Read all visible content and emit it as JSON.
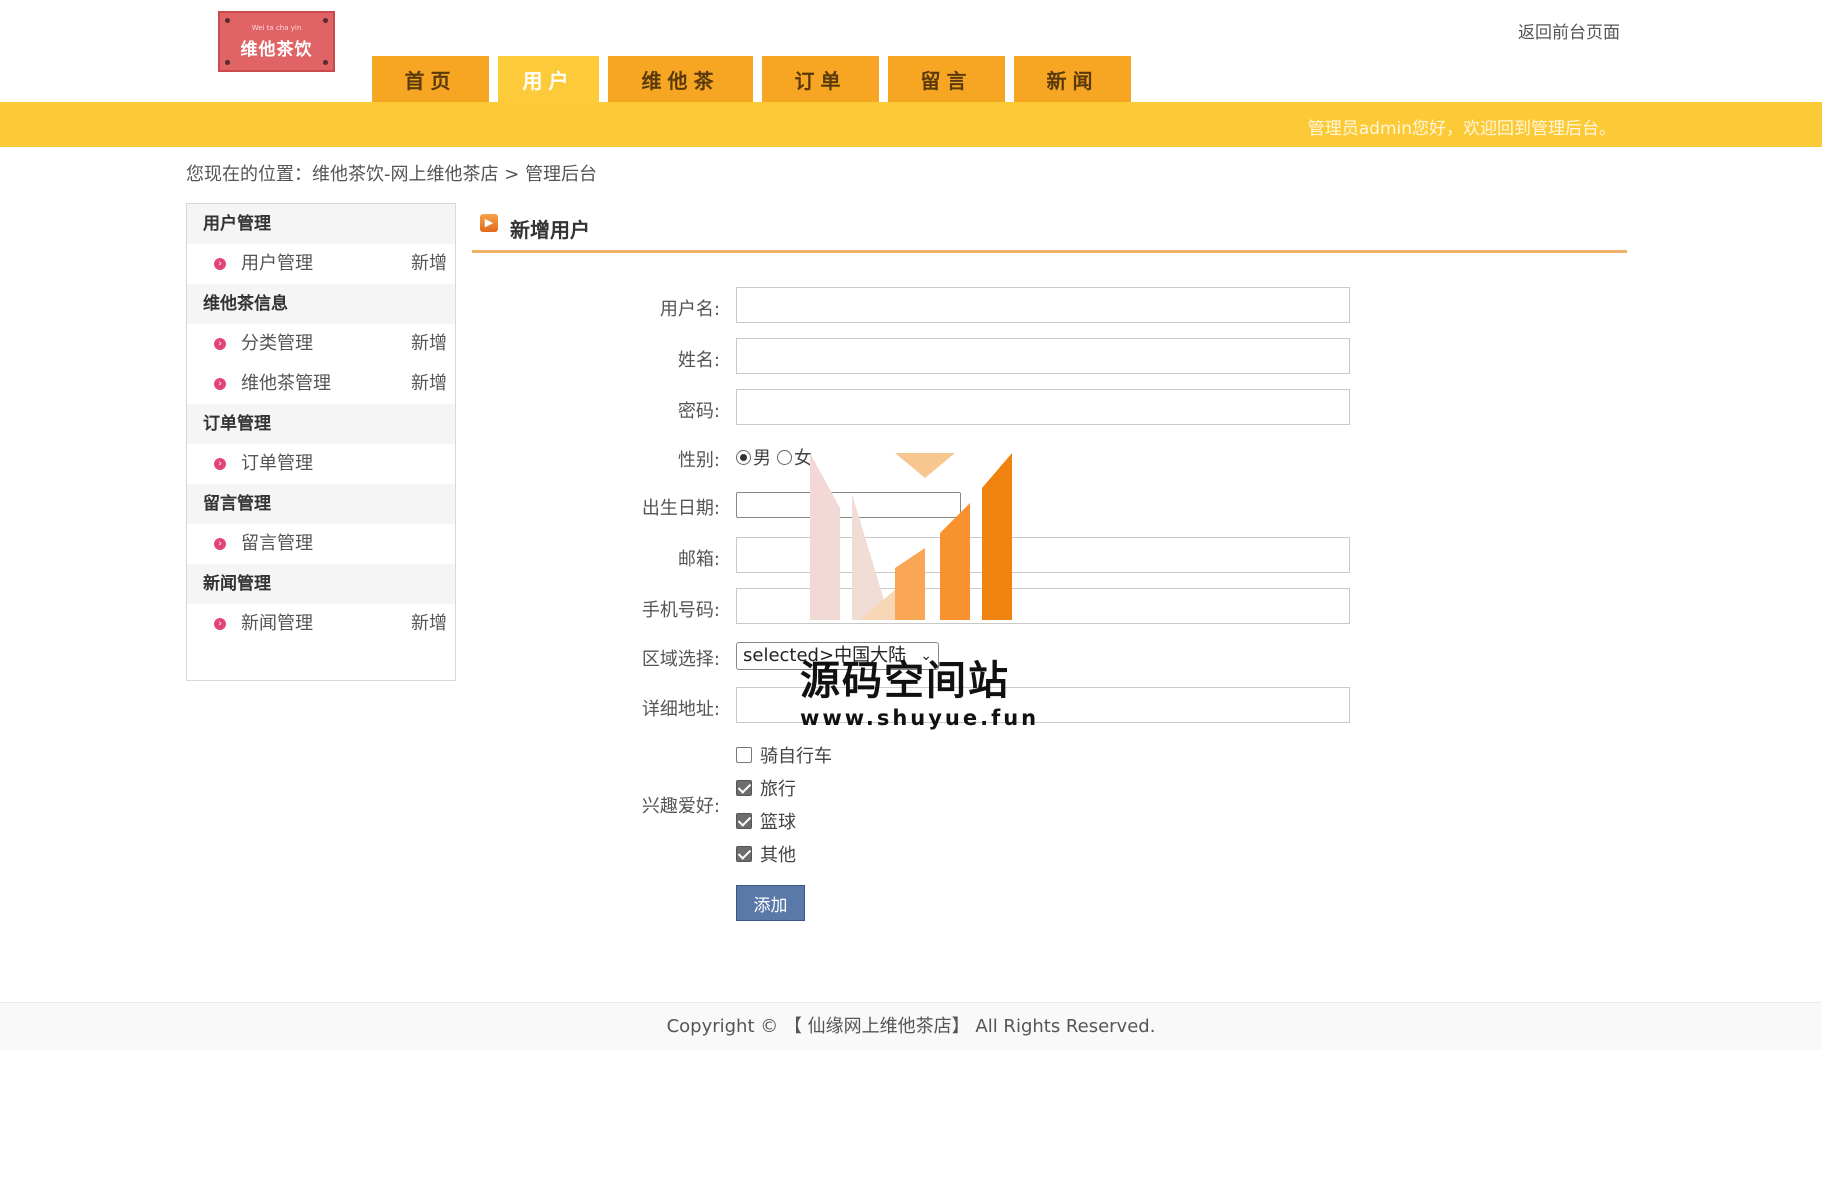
{
  "header": {
    "logo_small_text": "Wei ta cha yin",
    "logo_text": "维他茶饮",
    "back_link": "返回前台页面",
    "welcome": "管理员admin您好，欢迎回到管理后台。"
  },
  "nav": {
    "tabs": [
      {
        "label": "首页",
        "active": false
      },
      {
        "label": "用户",
        "active": true
      },
      {
        "label": "维他茶",
        "active": false
      },
      {
        "label": "订单",
        "active": false
      },
      {
        "label": "留言",
        "active": false
      },
      {
        "label": "新闻",
        "active": false
      }
    ]
  },
  "breadcrumb": {
    "prefix": "您现在的位置：",
    "site": "维他茶饮-网上维他茶店",
    "separator": ">",
    "current": "管理后台"
  },
  "sidebar": {
    "groups": [
      {
        "title": "用户管理",
        "items": [
          {
            "label": "用户管理",
            "add": "新增"
          }
        ]
      },
      {
        "title": "维他茶信息",
        "items": [
          {
            "label": "分类管理",
            "add": "新增"
          },
          {
            "label": "维他茶管理",
            "add": "新增"
          }
        ]
      },
      {
        "title": "订单管理",
        "items": [
          {
            "label": "订单管理",
            "add": ""
          }
        ]
      },
      {
        "title": "留言管理",
        "items": [
          {
            "label": "留言管理",
            "add": ""
          }
        ]
      },
      {
        "title": "新闻管理",
        "items": [
          {
            "label": "新闻管理",
            "add": "新增"
          }
        ]
      }
    ]
  },
  "main": {
    "title": "新增用户"
  },
  "form": {
    "username_label": "用户名:",
    "username_value": "",
    "name_label": "姓名:",
    "name_value": "",
    "password_label": "密码:",
    "password_value": "",
    "gender_label": "性别:",
    "gender_male": "男",
    "gender_female": "女",
    "gender_selected": "男",
    "birthday_label": "出生日期:",
    "birthday_value": "",
    "email_label": "邮箱:",
    "email_value": "",
    "phone_label": "手机号码:",
    "phone_value": "",
    "region_label": "区域选择:",
    "region_value": "selected>中国大陆",
    "address_label": "详细地址:",
    "address_value": "",
    "hobby_label": "兴趣爱好:",
    "hobbies": [
      {
        "label": "骑自行车",
        "checked": false
      },
      {
        "label": "旅行",
        "checked": true
      },
      {
        "label": "篮球",
        "checked": true
      },
      {
        "label": "其他",
        "checked": true
      }
    ],
    "submit_label": "添加"
  },
  "watermark": {
    "title": "源码空间站",
    "url": "www.shuyue.fun"
  },
  "footer": {
    "copyright": "Copyright © 【 仙缘网上维他茶店】 All Rights Reserved."
  },
  "colors": {
    "nav_tab": "#f6a623",
    "nav_tab_active": "#fdcb3a",
    "yellow_bar": "#fdca37",
    "submit": "#5a78a8",
    "title_underline": "#f0b169"
  }
}
